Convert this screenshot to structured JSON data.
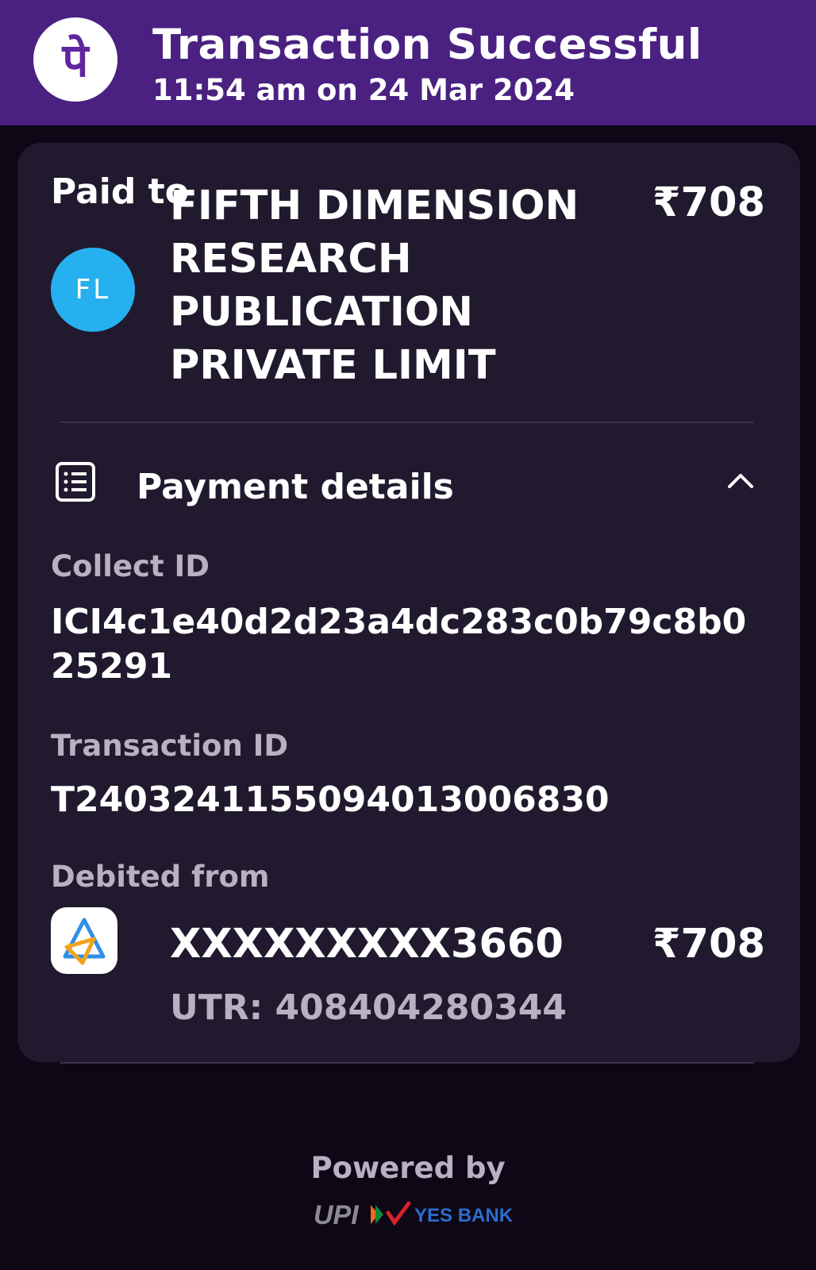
{
  "header": {
    "title": "Transaction Successful",
    "subtitle": "11:54 am on 24 Mar 2024",
    "logo_icon": "phonepe-logo",
    "logo_glyph": "पे"
  },
  "payee": {
    "paid_to_label": "Paid to",
    "name": "FIFTH DIMENSION RESEARCH PUBLICATION PRIVATE LIMIT",
    "avatar_initials": "FL",
    "avatar_color": "#27b0ef",
    "amount": "₹708"
  },
  "payment_details": {
    "title": "Payment details",
    "icon": "receipt-list-icon",
    "expanded": true,
    "collect_id_label": "Collect ID",
    "collect_id": "ICI4c1e40d2d23a4dc283c0b79c8b025291",
    "transaction_id_label": "Transaction ID",
    "transaction_id": "T2403241155094013006830",
    "debited_from_label": "Debited from",
    "account": "XXXXXXXXX3660",
    "account_amount": "₹708",
    "utr": "UTR: 408404280344"
  },
  "footer": {
    "powered_by": "Powered by",
    "partner_bank": "YES BANK",
    "upi_label": "UPI"
  },
  "colors": {
    "header_bg": "#4a2180",
    "page_bg": "#0d0716",
    "card_bg": "#211a2e",
    "muted_text": "#b8b1c2"
  }
}
